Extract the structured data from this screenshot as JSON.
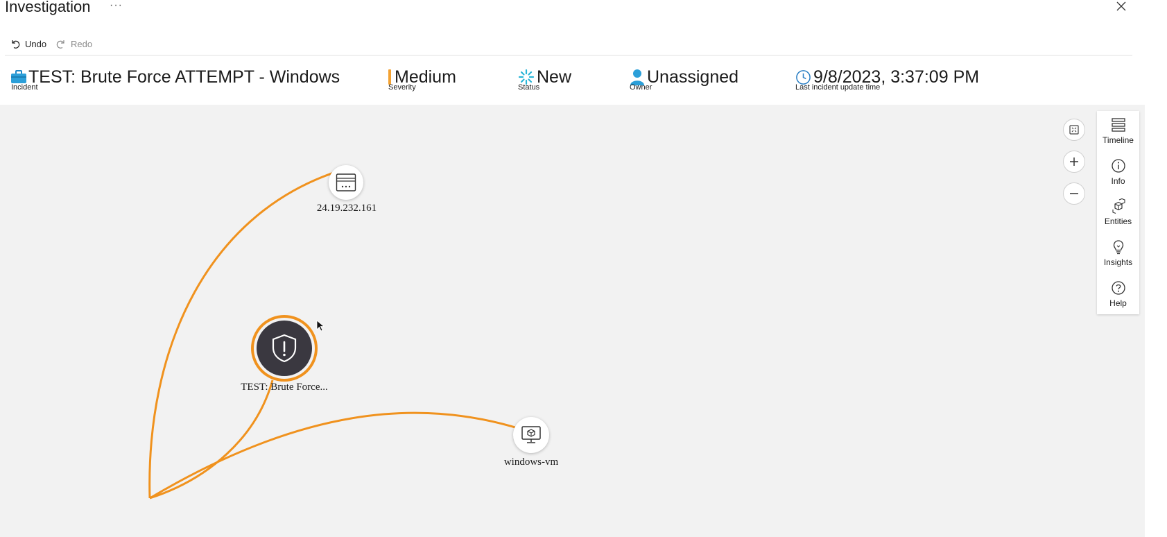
{
  "window": {
    "title": "Investigation",
    "more_label": "···",
    "close_icon": "close-icon"
  },
  "toolbar": {
    "undo_label": "Undo",
    "redo_label": "Redo"
  },
  "incident": {
    "name": "TEST: Brute Force ATTEMPT - Windows",
    "name_label": "Incident",
    "severity": "Medium",
    "severity_label": "Severity",
    "severity_color": "#f3a233",
    "status": "New",
    "status_label": "Status",
    "owner": "Unassigned",
    "owner_label": "Owner",
    "updated": "9/8/2023, 3:37:09 PM",
    "updated_label": "Last incident update time"
  },
  "graph": {
    "edge_color": "#f0921e",
    "nodes": {
      "ip": {
        "label": "24.19.232.161",
        "icon": "ip-address-icon"
      },
      "alert": {
        "label": "TEST: Brute Force...",
        "icon": "shield-alert-icon"
      },
      "host": {
        "label": "windows-vm",
        "icon": "computer-icon"
      }
    }
  },
  "sidebar": {
    "items": [
      {
        "label": "Timeline",
        "icon": "timeline-icon"
      },
      {
        "label": "Info",
        "icon": "info-icon"
      },
      {
        "label": "Entities",
        "icon": "entities-icon"
      },
      {
        "label": "Insights",
        "icon": "lightbulb-icon"
      },
      {
        "label": "Help",
        "icon": "help-icon"
      }
    ]
  }
}
